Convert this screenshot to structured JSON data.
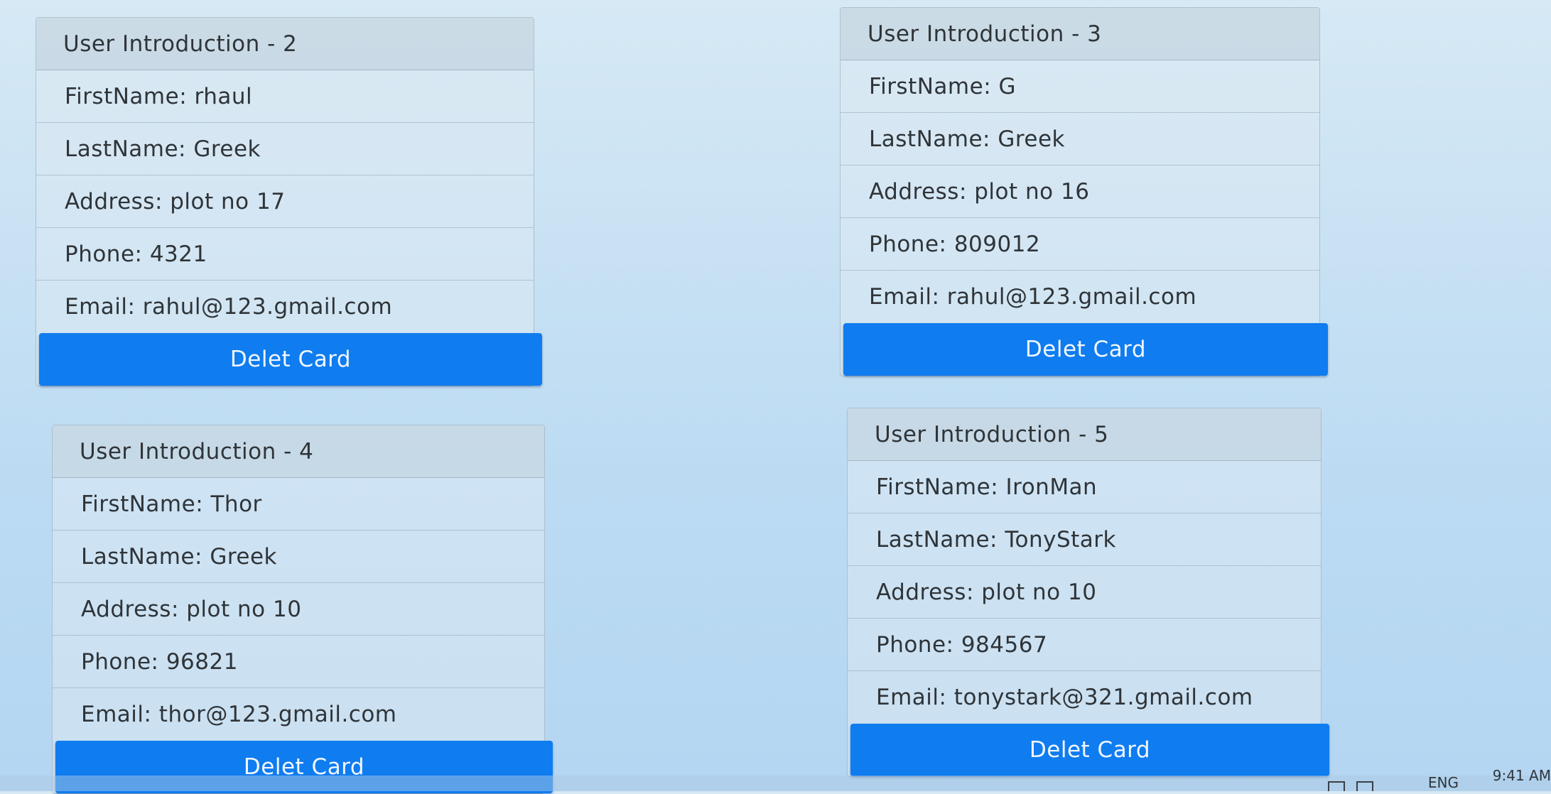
{
  "cards": [
    {
      "title": "User Introduction - 2",
      "first_name": "FirstName: rhaul",
      "last_name": "LastName: Greek",
      "address": "Address: plot no 17",
      "phone": "Phone: 4321",
      "email": "Email: rahul@123.gmail.com",
      "button_label": "Delet Card"
    },
    {
      "title": "User Introduction - 3",
      "first_name": "FirstName: G",
      "last_name": "LastName: Greek",
      "address": "Address: plot no 16",
      "phone": "Phone: 809012",
      "email": "Email: rahul@123.gmail.com",
      "button_label": "Delet Card"
    },
    {
      "title": "User Introduction - 4",
      "first_name": "FirstName: Thor",
      "last_name": "LastName: Greek",
      "address": "Address: plot no 10",
      "phone": "Phone: 96821",
      "email": "Email: thor@123.gmail.com",
      "button_label": "Delet Card"
    },
    {
      "title": "User Introduction - 5",
      "first_name": "FirstName: IronMan",
      "last_name": "LastName: TonyStark",
      "address": "Address: plot no 10",
      "phone": "Phone: 984567",
      "email": "Email: tonystark@321.gmail.com",
      "button_label": "Delet Card"
    }
  ],
  "taskbar": {
    "language": "ENG",
    "time": "9:41 AM"
  },
  "colors": {
    "button_primary": "#0f7cf0",
    "button_text": "#f1f7ff",
    "background": "#c9e2f3"
  }
}
